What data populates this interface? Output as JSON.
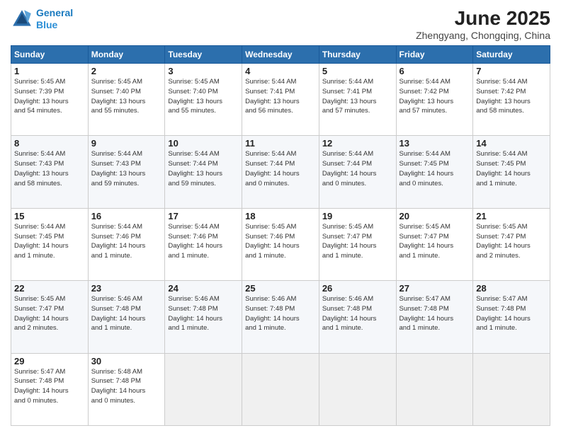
{
  "header": {
    "logo_line1": "General",
    "logo_line2": "Blue",
    "title": "June 2025",
    "subtitle": "Zhengyang, Chongqing, China"
  },
  "days_of_week": [
    "Sunday",
    "Monday",
    "Tuesday",
    "Wednesday",
    "Thursday",
    "Friday",
    "Saturday"
  ],
  "weeks": [
    [
      {
        "day": "1",
        "detail": "Sunrise: 5:45 AM\nSunset: 7:39 PM\nDaylight: 13 hours\nand 54 minutes."
      },
      {
        "day": "2",
        "detail": "Sunrise: 5:45 AM\nSunset: 7:40 PM\nDaylight: 13 hours\nand 55 minutes."
      },
      {
        "day": "3",
        "detail": "Sunrise: 5:45 AM\nSunset: 7:40 PM\nDaylight: 13 hours\nand 55 minutes."
      },
      {
        "day": "4",
        "detail": "Sunrise: 5:44 AM\nSunset: 7:41 PM\nDaylight: 13 hours\nand 56 minutes."
      },
      {
        "day": "5",
        "detail": "Sunrise: 5:44 AM\nSunset: 7:41 PM\nDaylight: 13 hours\nand 57 minutes."
      },
      {
        "day": "6",
        "detail": "Sunrise: 5:44 AM\nSunset: 7:42 PM\nDaylight: 13 hours\nand 57 minutes."
      },
      {
        "day": "7",
        "detail": "Sunrise: 5:44 AM\nSunset: 7:42 PM\nDaylight: 13 hours\nand 58 minutes."
      }
    ],
    [
      {
        "day": "8",
        "detail": "Sunrise: 5:44 AM\nSunset: 7:43 PM\nDaylight: 13 hours\nand 58 minutes."
      },
      {
        "day": "9",
        "detail": "Sunrise: 5:44 AM\nSunset: 7:43 PM\nDaylight: 13 hours\nand 59 minutes."
      },
      {
        "day": "10",
        "detail": "Sunrise: 5:44 AM\nSunset: 7:44 PM\nDaylight: 13 hours\nand 59 minutes."
      },
      {
        "day": "11",
        "detail": "Sunrise: 5:44 AM\nSunset: 7:44 PM\nDaylight: 14 hours\nand 0 minutes."
      },
      {
        "day": "12",
        "detail": "Sunrise: 5:44 AM\nSunset: 7:44 PM\nDaylight: 14 hours\nand 0 minutes."
      },
      {
        "day": "13",
        "detail": "Sunrise: 5:44 AM\nSunset: 7:45 PM\nDaylight: 14 hours\nand 0 minutes."
      },
      {
        "day": "14",
        "detail": "Sunrise: 5:44 AM\nSunset: 7:45 PM\nDaylight: 14 hours\nand 1 minute."
      }
    ],
    [
      {
        "day": "15",
        "detail": "Sunrise: 5:44 AM\nSunset: 7:45 PM\nDaylight: 14 hours\nand 1 minute."
      },
      {
        "day": "16",
        "detail": "Sunrise: 5:44 AM\nSunset: 7:46 PM\nDaylight: 14 hours\nand 1 minute."
      },
      {
        "day": "17",
        "detail": "Sunrise: 5:44 AM\nSunset: 7:46 PM\nDaylight: 14 hours\nand 1 minute."
      },
      {
        "day": "18",
        "detail": "Sunrise: 5:45 AM\nSunset: 7:46 PM\nDaylight: 14 hours\nand 1 minute."
      },
      {
        "day": "19",
        "detail": "Sunrise: 5:45 AM\nSunset: 7:47 PM\nDaylight: 14 hours\nand 1 minute."
      },
      {
        "day": "20",
        "detail": "Sunrise: 5:45 AM\nSunset: 7:47 PM\nDaylight: 14 hours\nand 1 minute."
      },
      {
        "day": "21",
        "detail": "Sunrise: 5:45 AM\nSunset: 7:47 PM\nDaylight: 14 hours\nand 2 minutes."
      }
    ],
    [
      {
        "day": "22",
        "detail": "Sunrise: 5:45 AM\nSunset: 7:47 PM\nDaylight: 14 hours\nand 2 minutes."
      },
      {
        "day": "23",
        "detail": "Sunrise: 5:46 AM\nSunset: 7:48 PM\nDaylight: 14 hours\nand 1 minute."
      },
      {
        "day": "24",
        "detail": "Sunrise: 5:46 AM\nSunset: 7:48 PM\nDaylight: 14 hours\nand 1 minute."
      },
      {
        "day": "25",
        "detail": "Sunrise: 5:46 AM\nSunset: 7:48 PM\nDaylight: 14 hours\nand 1 minute."
      },
      {
        "day": "26",
        "detail": "Sunrise: 5:46 AM\nSunset: 7:48 PM\nDaylight: 14 hours\nand 1 minute."
      },
      {
        "day": "27",
        "detail": "Sunrise: 5:47 AM\nSunset: 7:48 PM\nDaylight: 14 hours\nand 1 minute."
      },
      {
        "day": "28",
        "detail": "Sunrise: 5:47 AM\nSunset: 7:48 PM\nDaylight: 14 hours\nand 1 minute."
      }
    ],
    [
      {
        "day": "29",
        "detail": "Sunrise: 5:47 AM\nSunset: 7:48 PM\nDaylight: 14 hours\nand 0 minutes."
      },
      {
        "day": "30",
        "detail": "Sunrise: 5:48 AM\nSunset: 7:48 PM\nDaylight: 14 hours\nand 0 minutes."
      },
      {
        "day": "",
        "detail": ""
      },
      {
        "day": "",
        "detail": ""
      },
      {
        "day": "",
        "detail": ""
      },
      {
        "day": "",
        "detail": ""
      },
      {
        "day": "",
        "detail": ""
      }
    ]
  ]
}
